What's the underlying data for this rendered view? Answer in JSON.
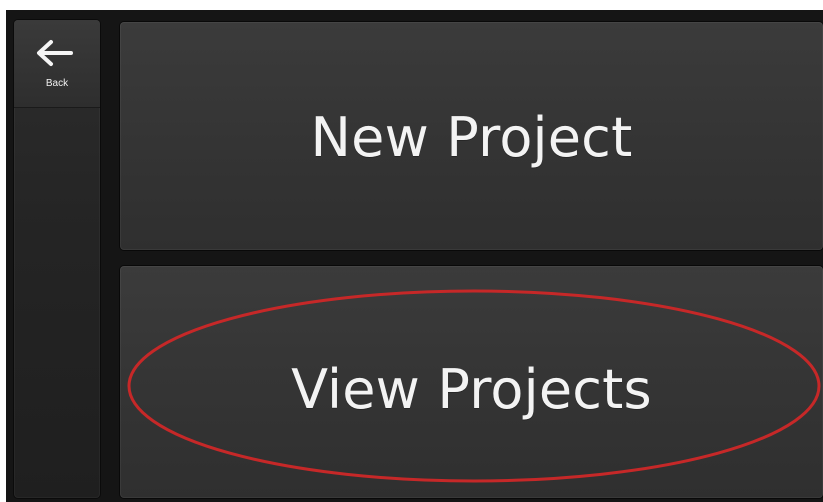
{
  "sidebar": {
    "back_label": "Back",
    "back_icon": "left-arrow-icon"
  },
  "main": {
    "new_project_label": "New Project",
    "view_projects_label": "View Projects"
  },
  "annotation": {
    "shape": "ellipse",
    "color": "#c62828",
    "target": "view-projects-button"
  },
  "colors": {
    "frame_background": "#151515",
    "panel_background": "#363636",
    "text": "#f3f3f3"
  }
}
